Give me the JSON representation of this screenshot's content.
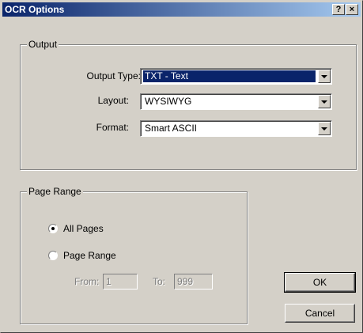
{
  "window": {
    "title": "OCR Options",
    "help_button": "?",
    "close_button": "×"
  },
  "output_group": {
    "legend": "Output",
    "output_type": {
      "label": "Output Type:",
      "value": "TXT - Text"
    },
    "layout": {
      "label": "Layout:",
      "value": "WYSIWYG"
    },
    "format": {
      "label": "Format:",
      "value": "Smart ASCII"
    }
  },
  "page_range_group": {
    "legend": "Page Range",
    "all_pages": {
      "label": "All Pages",
      "checked": true
    },
    "page_range": {
      "label": "Page Range",
      "checked": false
    },
    "from": {
      "label": "From:",
      "value": "1"
    },
    "to": {
      "label": "To:",
      "value": "999"
    }
  },
  "buttons": {
    "ok": "OK",
    "cancel": "Cancel"
  },
  "colors": {
    "titlebar_start": "#0a246a",
    "titlebar_end": "#a6caf0",
    "face": "#d4d0c8"
  }
}
